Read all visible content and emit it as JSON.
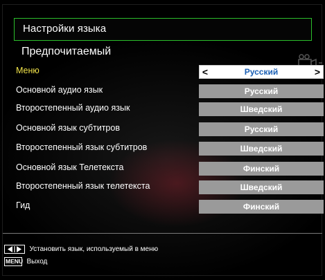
{
  "header": {
    "title": "Настройки языка"
  },
  "section": {
    "title": "Предпочитаемый"
  },
  "rows": [
    {
      "label": "Меню",
      "value": "Русский",
      "active": true
    },
    {
      "label": "Основной аудио язык",
      "value": "Русский"
    },
    {
      "label": "Второстепенный аудио язык",
      "value": "Шведский"
    },
    {
      "label": "Основной язык субтитров",
      "value": "Русский"
    },
    {
      "label": "Второстепенный язык субтитров",
      "value": "Шведский"
    },
    {
      "label": "Основной язык Телетекста",
      "value": "Финский"
    },
    {
      "label": "Второстепенный язык телетекста",
      "value": "Шведский"
    },
    {
      "label": "Гид",
      "value": "Финский"
    }
  ],
  "selector": {
    "left_arrow": "<",
    "right_arrow": ">"
  },
  "footer": {
    "hint_lr": "Установить язык, используемый в меню",
    "menu_key": "MENU",
    "hint_menu": "Выход"
  },
  "colors": {
    "title_border": "#2bbf2b",
    "active_label": "#f1e34a",
    "active_value_text": "#1a5fb4",
    "value_box": "#9a9a9a"
  },
  "icons": {
    "camera": "camera-icon",
    "left_right_keys": "left-right-keys-icon"
  }
}
